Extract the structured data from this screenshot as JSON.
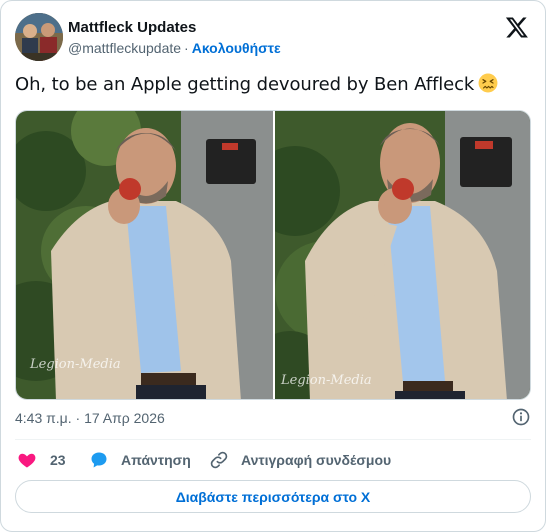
{
  "author": {
    "display_name": "Mattfleck Updates",
    "handle": "@mattfleckupdate",
    "separator": "·",
    "follow_label": "Ακολουθήστε"
  },
  "tweet": {
    "text": "Oh, to be an Apple getting devoured by Ben Affleck",
    "emoji": "confounded-face-emoji"
  },
  "media": {
    "watermark_left": "Legion-Media",
    "watermark_right": "Legion-Media"
  },
  "meta": {
    "timestamp": "4:43 π.μ. · 17 Απρ 2026"
  },
  "actions": {
    "like_count": "23",
    "reply_label": "Απάντηση",
    "copy_link_label": "Αντιγραφή συνδέσμου"
  },
  "footer": {
    "read_more_label": "Διαβάστε περισσότερα στο X"
  },
  "colors": {
    "like": "#f91880",
    "reply": "#1d9bf0",
    "link": "#006fd6",
    "secondary_text": "#536471",
    "border": "#cfd9de"
  }
}
